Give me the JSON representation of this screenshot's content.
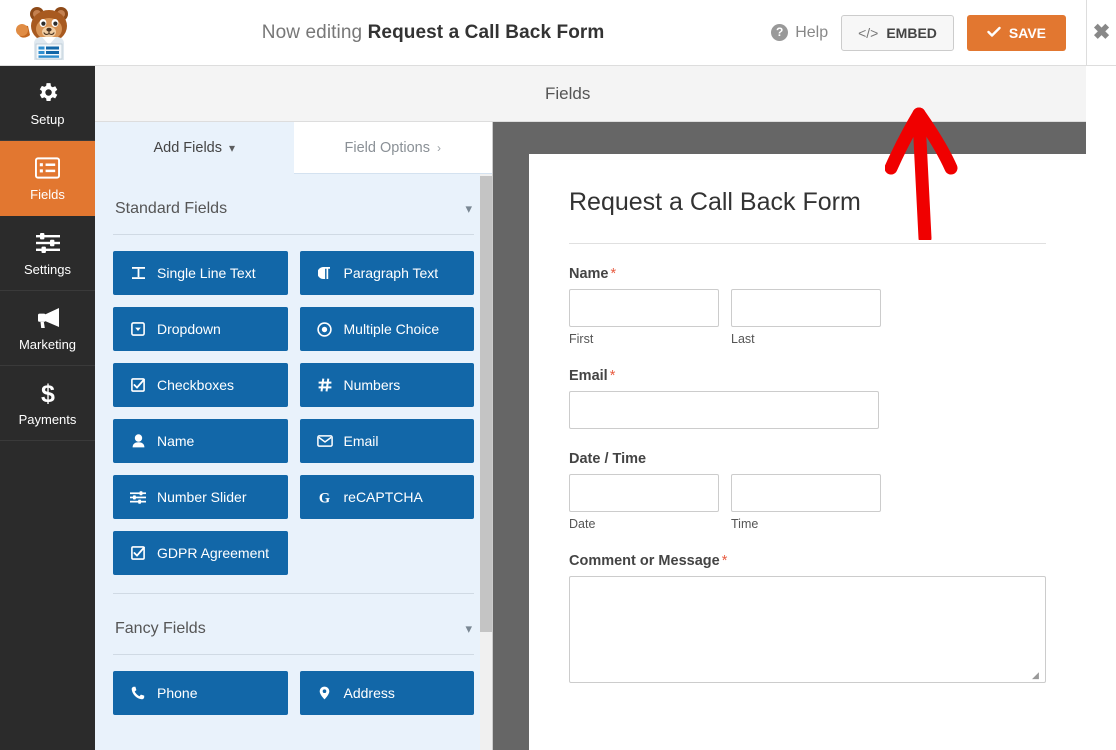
{
  "header": {
    "editing_prefix": "Now editing",
    "form_name": "Request a Call Back Form",
    "help_label": "Help",
    "help_icon": "question-circle-icon",
    "embed_label": "EMBED",
    "embed_icon": "code-icon",
    "save_label": "SAVE",
    "save_icon": "check-icon",
    "close_icon": "close-icon",
    "logo_icon": "wpforms-mascot-logo",
    "accent_orange": "#e27730",
    "field_blue": "#1267a8"
  },
  "sidebar": {
    "items": [
      {
        "label": "Setup",
        "icon": "gear-icon",
        "active": false
      },
      {
        "label": "Fields",
        "icon": "list-icon",
        "active": true
      },
      {
        "label": "Settings",
        "icon": "sliders-icon",
        "active": false
      },
      {
        "label": "Marketing",
        "icon": "megaphone-icon",
        "active": false
      },
      {
        "label": "Payments",
        "icon": "dollar-icon",
        "active": false
      }
    ]
  },
  "panel": {
    "title": "Fields"
  },
  "tabs": {
    "add_fields": {
      "label": "Add Fields",
      "chevron": "chevron-down-icon",
      "active": true
    },
    "field_options": {
      "label": "Field Options",
      "chevron": "chevron-right-icon",
      "active": false
    }
  },
  "field_sections": [
    {
      "title": "Standard Fields",
      "chevron": "chevron-down-icon",
      "fields": [
        {
          "label": "Single Line Text",
          "icon": "text-width-icon"
        },
        {
          "label": "Paragraph Text",
          "icon": "paragraph-icon"
        },
        {
          "label": "Dropdown",
          "icon": "caret-square-down-icon"
        },
        {
          "label": "Multiple Choice",
          "icon": "radio-dot-icon"
        },
        {
          "label": "Checkboxes",
          "icon": "check-square-icon"
        },
        {
          "label": "Numbers",
          "icon": "hashtag-icon"
        },
        {
          "label": "Name",
          "icon": "user-icon"
        },
        {
          "label": "Email",
          "icon": "envelope-icon"
        },
        {
          "label": "Number Slider",
          "icon": "sliders-icon"
        },
        {
          "label": "reCAPTCHA",
          "icon": "google-g-icon"
        },
        {
          "label": "GDPR Agreement",
          "icon": "check-square-icon"
        }
      ]
    },
    {
      "title": "Fancy Fields",
      "chevron": "chevron-down-icon",
      "fields": [
        {
          "label": "Phone",
          "icon": "phone-icon"
        },
        {
          "label": "Address",
          "icon": "map-marker-icon"
        }
      ]
    }
  ],
  "form_preview": {
    "title": "Request a Call Back Form",
    "required_marker": "*",
    "fields": [
      {
        "label": "Name",
        "required": true,
        "type": "name",
        "subfields": [
          {
            "sub_label": "First",
            "value": ""
          },
          {
            "sub_label": "Last",
            "value": ""
          }
        ]
      },
      {
        "label": "Email",
        "required": true,
        "type": "email",
        "value": ""
      },
      {
        "label": "Date / Time",
        "required": false,
        "type": "datetime",
        "subfields": [
          {
            "sub_label": "Date",
            "value": ""
          },
          {
            "sub_label": "Time",
            "value": ""
          }
        ]
      },
      {
        "label": "Comment or Message",
        "required": true,
        "type": "textarea",
        "value": ""
      }
    ]
  },
  "annotation": {
    "type": "red-arrow-pointing-up",
    "target": "embed-button",
    "color": "#f00000"
  }
}
